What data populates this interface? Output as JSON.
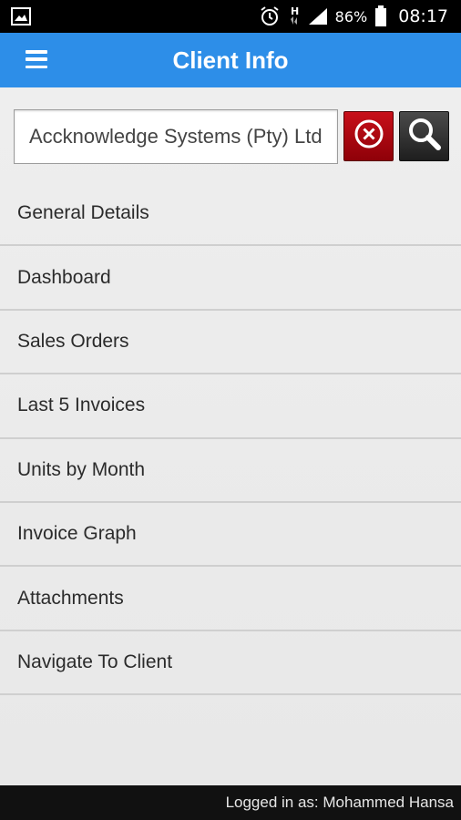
{
  "status_bar": {
    "battery": "86%",
    "time": "08:17",
    "network_indicator": "H",
    "icons": [
      "image-icon",
      "alarm-icon",
      "signal-icon",
      "battery-icon"
    ]
  },
  "app_bar": {
    "title": "Client Info"
  },
  "search": {
    "value": "Accknowledge Systems (Pty) Ltd"
  },
  "menu": {
    "items": [
      {
        "label": "General Details"
      },
      {
        "label": "Dashboard"
      },
      {
        "label": "Sales Orders"
      },
      {
        "label": "Last 5 Invoices"
      },
      {
        "label": "Units by Month"
      },
      {
        "label": "Invoice Graph"
      },
      {
        "label": "Attachments"
      },
      {
        "label": "Navigate To Client"
      }
    ]
  },
  "footer": {
    "logged_in_text": "Logged in as: Mohammed Hansa"
  },
  "colors": {
    "app_bar": "#2d8ee8",
    "clear_button": "#b00010",
    "search_button": "#333333",
    "footer": "#111111"
  }
}
